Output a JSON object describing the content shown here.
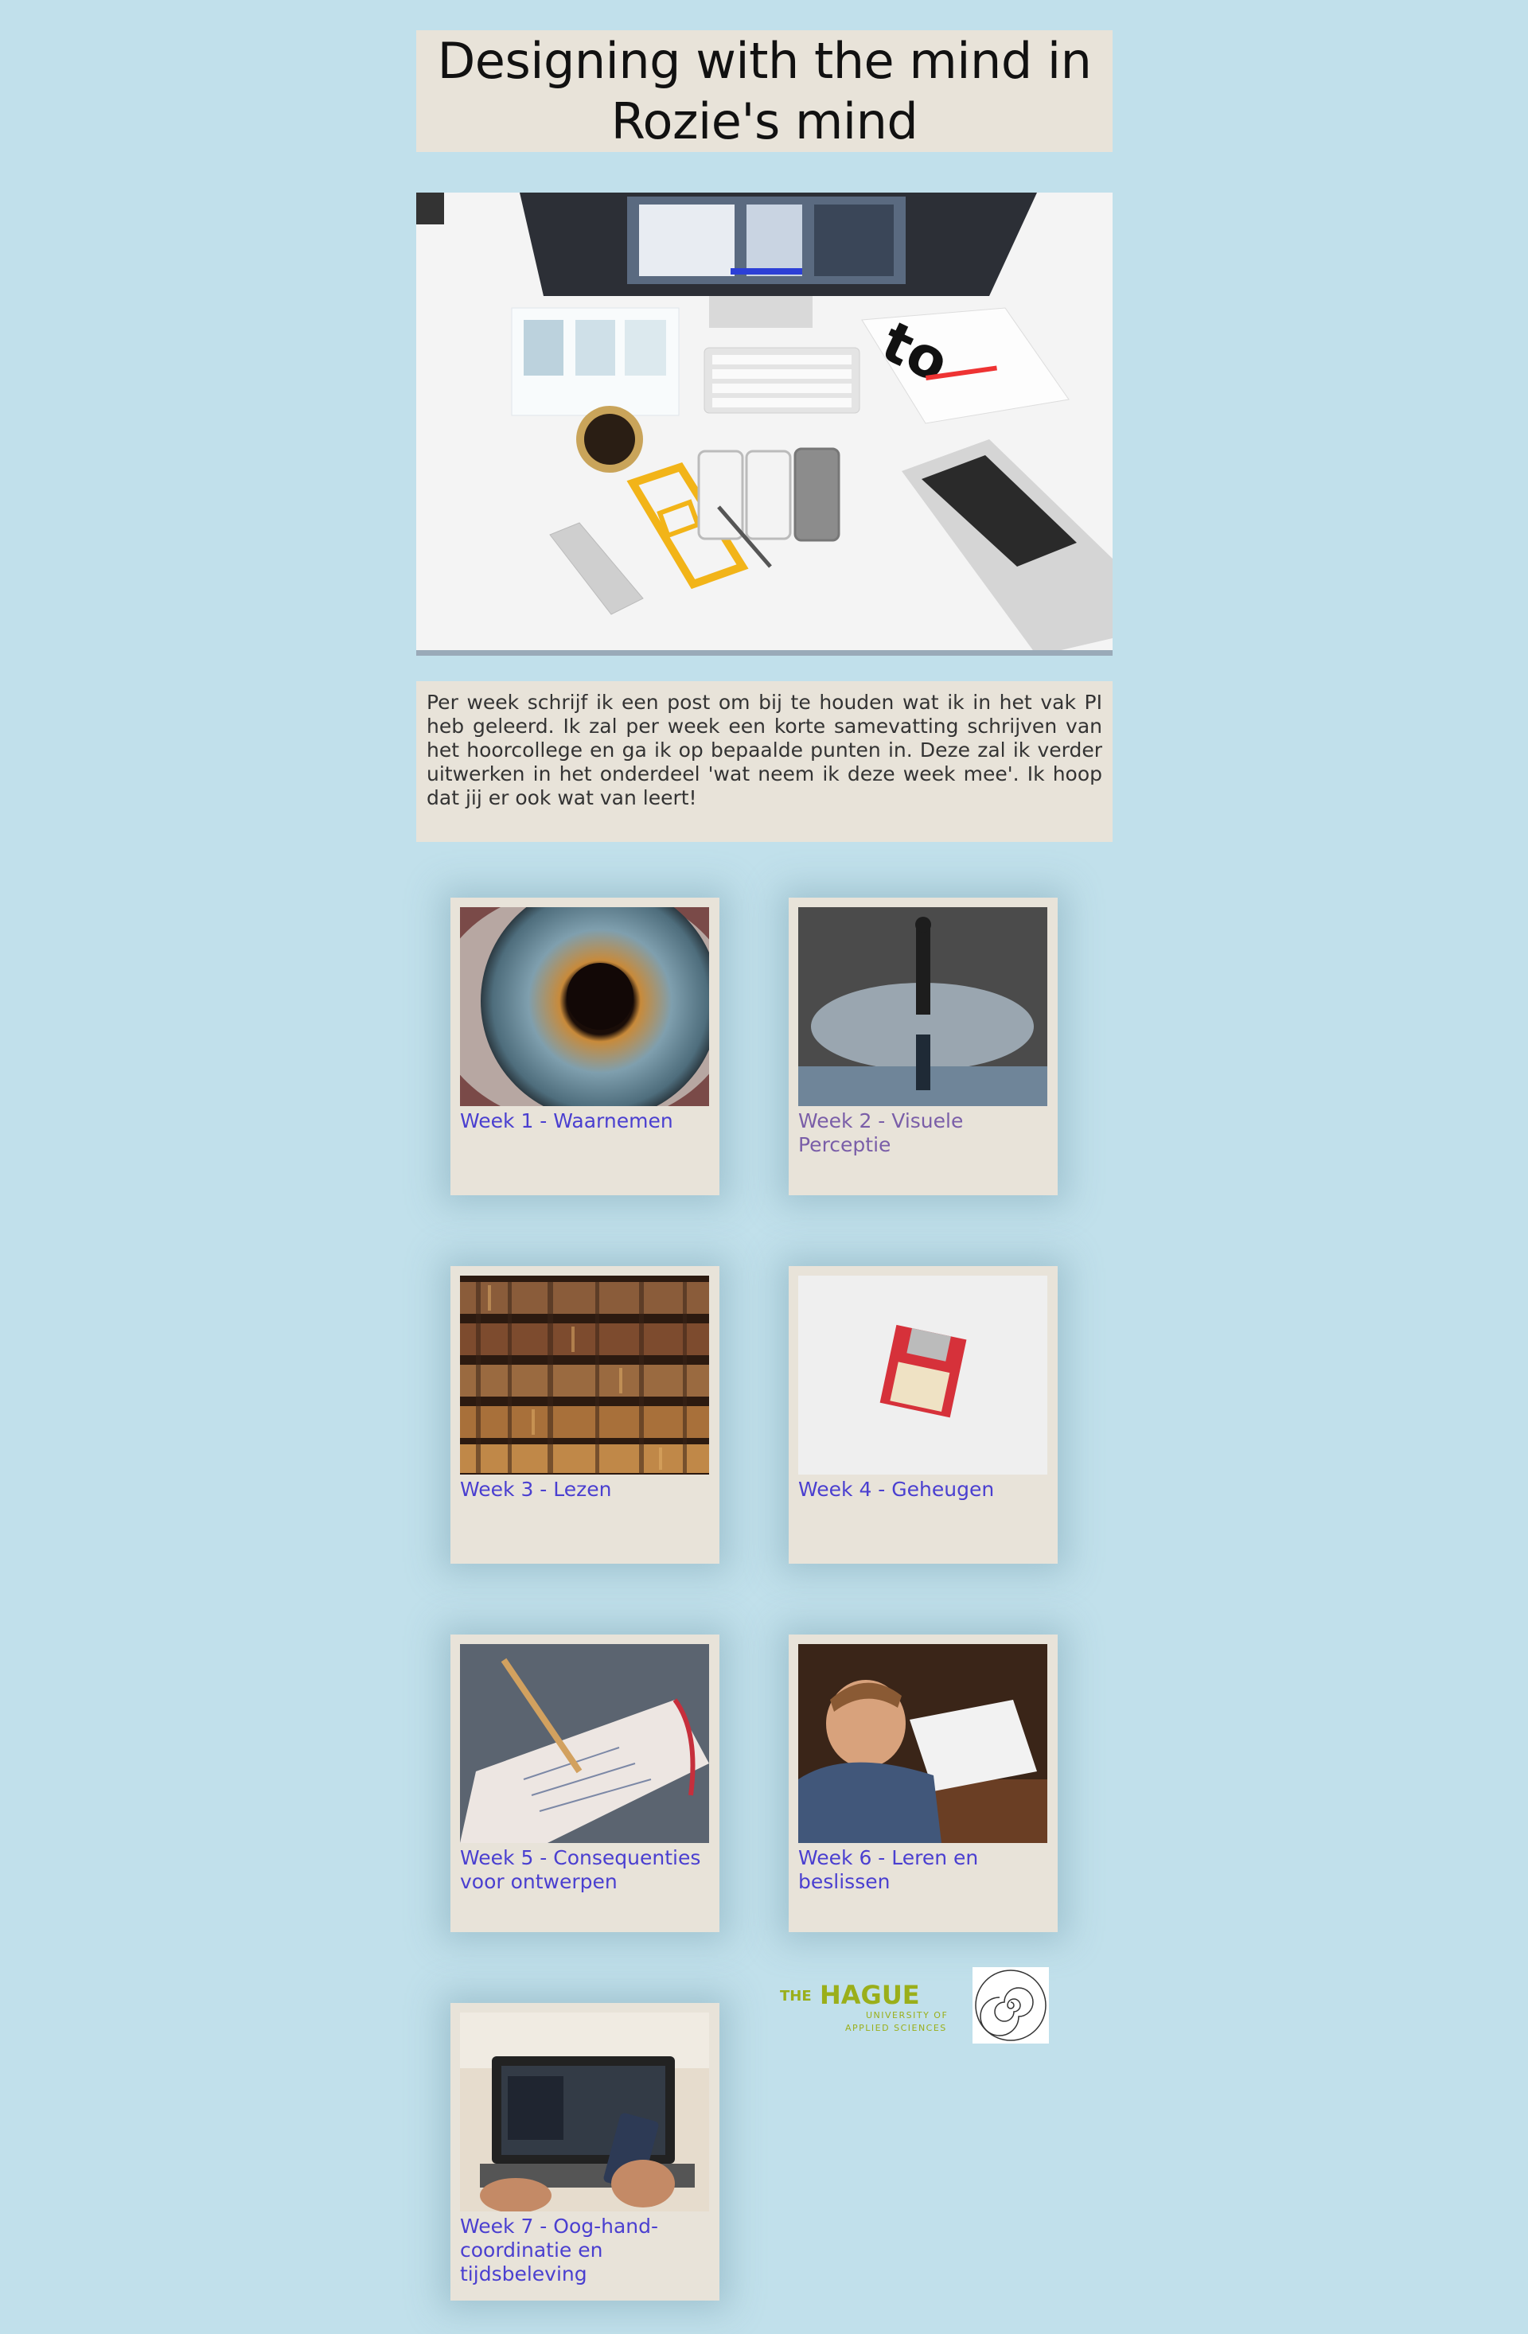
{
  "header": {
    "title": "Designing with the mind in Rozie's mind"
  },
  "intro": {
    "text": "Per week schrijf ik een post om bij te houden wat ik in het vak PI heb geleerd. Ik zal per week een korte samevatting schrijven van het hoorcollege en ga ik op bepaalde punten in. Deze zal ik verder uitwerken in het onderdeel 'wat neem ik deze week mee'. Ik hoop dat jij er ook wat van leert!"
  },
  "hero": {
    "image": "desk-workspace-image"
  },
  "weeks": [
    {
      "label": "Week 1 - Waarnemen",
      "image": "eye-closeup-image"
    },
    {
      "label": "Week 2 - Visuele Perceptie",
      "image": "puddle-reflection-image"
    },
    {
      "label": "Week 3 - Lezen",
      "image": "bookshelf-image"
    },
    {
      "label": "Week 4 - Geheugen",
      "image": "floppy-disk-image"
    },
    {
      "label": "Week 5 - Consequenties voor ontwerpen",
      "image": "sketchbook-pencil-image"
    },
    {
      "label": "Week 6 - Leren en beslissen",
      "image": "child-writing-image"
    },
    {
      "label": "Week 7 - Oog-hand-coordinatie en tijdsbeleving",
      "image": "laptop-phone-image"
    }
  ],
  "footer": {
    "logo_the": "THE",
    "logo_hague": "HAGUE",
    "logo_line1": "UNIVERSITY OF",
    "logo_line2": "APPLIED SCIENCES"
  },
  "colors": {
    "background": "#c1e0eb",
    "panel": "#e8e3d9",
    "link": "#4a3fd0",
    "link_visited": "#7a5ea8",
    "logo_green": "#9aaf1a"
  }
}
